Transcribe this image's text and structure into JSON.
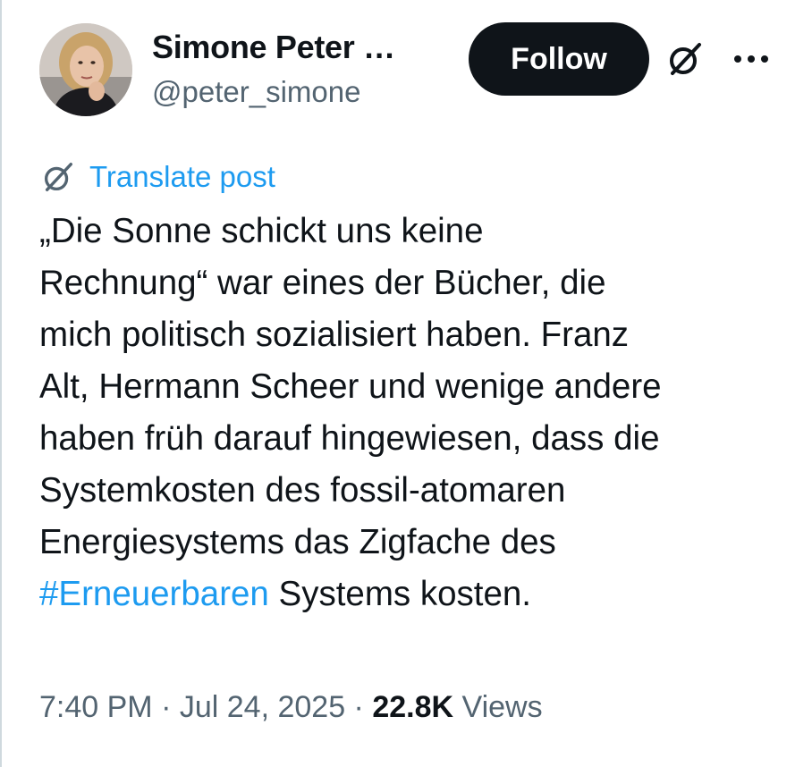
{
  "author": {
    "display_name": "Simone Peter …",
    "handle": "@peter_simone"
  },
  "header": {
    "follow_label": "Follow",
    "grok_icon": "grok-icon",
    "more_icon": "more-options-icon"
  },
  "translate": {
    "label": "Translate post",
    "icon": "grok-icon"
  },
  "post": {
    "lines": [
      "„Die Sonne schickt uns keine",
      "Rechnung“ war eines der Bücher, die",
      "mich politisch sozialisiert haben. Franz",
      "Alt, Hermann Scheer und wenige andere",
      "haben früh darauf hingewiesen, dass die",
      "Systemkosten des fossil-atomaren",
      "Energiesystems das Zigfache des"
    ],
    "hashtag": "#Erneuerbaren",
    "last_line_rest": " Systems kosten."
  },
  "meta": {
    "time": "7:40 PM",
    "separator": " · ",
    "date": "Jul 24, 2025",
    "views_count": "22.8K",
    "views_label": " Views"
  },
  "colors": {
    "text": "#0f1419",
    "secondary": "#536471",
    "link": "#1d9bf0",
    "button_bg": "#0f1419"
  }
}
